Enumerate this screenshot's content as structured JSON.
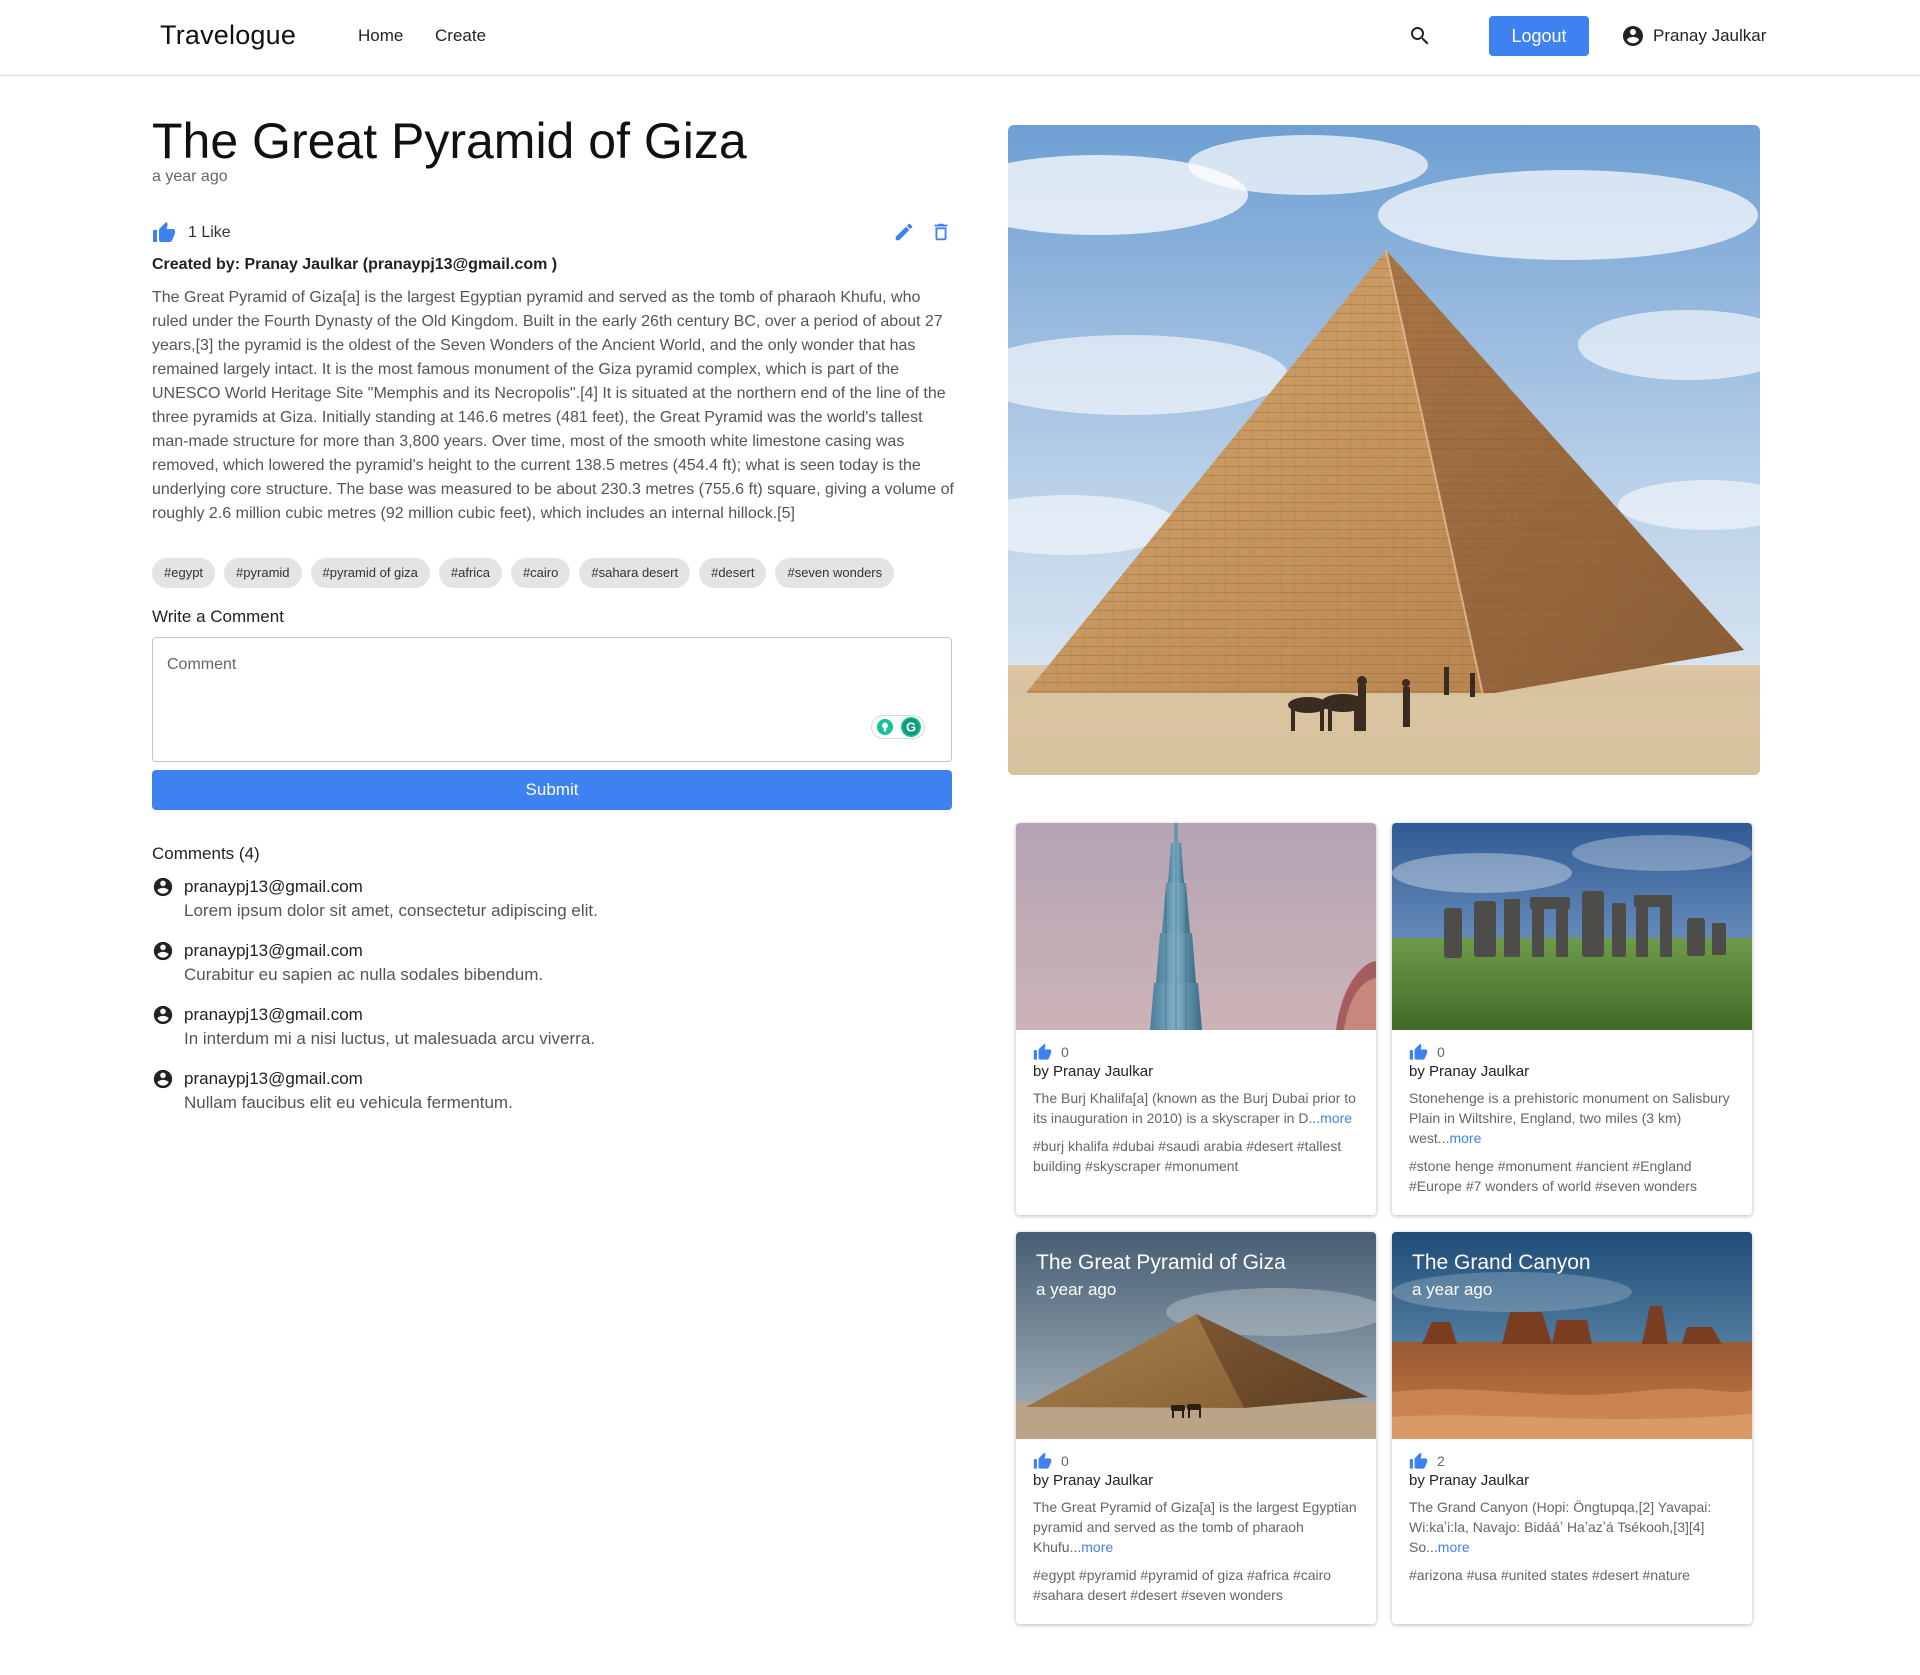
{
  "nav": {
    "brand": "Travelogue",
    "home": "Home",
    "create": "Create",
    "logout": "Logout",
    "user": "Pranay Jaulkar"
  },
  "post": {
    "title": "The Great Pyramid of Giza",
    "time": "a year ago",
    "likes": "1 Like",
    "created_by": "Created by: Pranay Jaulkar (pranaypj13@gmail.com )",
    "body": "The Great Pyramid of Giza[a] is the largest Egyptian pyramid and served as the tomb of pharaoh Khufu, who ruled under the Fourth Dynasty of the Old Kingdom. Built in the early 26th century BC, over a period of about 27 years,[3] the pyramid is the oldest of the Seven Wonders of the Ancient World, and the only wonder that has remained largely intact. It is the most famous monument of the Giza pyramid complex, which is part of the UNESCO World Heritage Site \"Memphis and its Necropolis\".[4] It is situated at the northern end of the line of the three pyramids at Giza. Initially standing at 146.6 metres (481 feet), the Great Pyramid was the world's tallest man-made structure for more than 3,800 years. Over time, most of the smooth white limestone casing was removed, which lowered the pyramid's height to the current 138.5 metres (454.4 ft); what is seen today is the underlying core structure. The base was measured to be about 230.3 metres (755.6 ft) square, giving a volume of roughly 2.6 million cubic metres (92 million cubic feet), which includes an internal hillock.[5]",
    "tags": [
      "#egypt",
      "#pyramid",
      "#pyramid of giza",
      "#africa",
      "#cairo",
      "#sahara desert",
      "#desert",
      "#seven wonders"
    ]
  },
  "comment_form": {
    "label": "Write a Comment",
    "placeholder": "Comment",
    "submit": "Submit"
  },
  "comments": {
    "label": "Comments (4)",
    "items": [
      {
        "user": "pranaypj13@gmail.com",
        "text": "Lorem ipsum dolor sit amet, consectetur adipiscing elit."
      },
      {
        "user": "pranaypj13@gmail.com",
        "text": "Curabitur eu sapien ac nulla sodales bibendum."
      },
      {
        "user": "pranaypj13@gmail.com",
        "text": "In interdum mi a nisi luctus, ut malesuada arcu viverra."
      },
      {
        "user": "pranaypj13@gmail.com",
        "text": "Nullam faucibus elit eu vehicula fermentum."
      }
    ]
  },
  "cards": [
    {
      "overlay_title": "",
      "overlay_time": "",
      "likes": "0",
      "author": "by Pranay Jaulkar",
      "desc": "The Burj Khalifa[a] (known as the Burj Dubai prior to its inauguration in 2010) is a skyscraper in D...",
      "more": "more",
      "tags": "#burj khalifa #dubai #saudi arabia #desert #tallest building #skyscraper #monument"
    },
    {
      "overlay_title": "",
      "overlay_time": "",
      "likes": "0",
      "author": "by Pranay Jaulkar",
      "desc": "Stonehenge is a prehistoric monument on Salisbury Plain in Wiltshire, England, two miles (3 km) west...",
      "more": "more",
      "tags": "#stone henge #monument #ancient #England #Europe #7 wonders of world #seven wonders"
    },
    {
      "overlay_title": "The Great Pyramid of Giza",
      "overlay_time": "a year ago",
      "likes": "0",
      "author": "by Pranay Jaulkar",
      "desc": "The Great Pyramid of Giza[a] is the largest Egyptian pyramid and served as the tomb of pharaoh Khufu...",
      "more": "more",
      "tags": "#egypt #pyramid #pyramid of giza #africa #cairo #sahara desert #desert #seven wonders"
    },
    {
      "overlay_title": "The Grand Canyon",
      "overlay_time": "a year ago",
      "likes": "2",
      "author": "by Pranay Jaulkar",
      "desc": "The Grand Canyon (Hopi: Öngtupqa,[2] Yavapai: Wi:kaʼi:la, Navajo: Bidááʼ Haʼazʼá Tsékooh,[3][4] So...",
      "more": "more",
      "tags": "#arizona #usa #united states #desert #nature"
    }
  ],
  "icons": {
    "search": "search-icon",
    "account": "account-circle-icon",
    "like": "thumb-up-icon",
    "edit": "pencil-icon",
    "delete": "trash-icon"
  },
  "colors": {
    "accent": "#3d82f0",
    "tag_bg": "#e4e4e4"
  }
}
